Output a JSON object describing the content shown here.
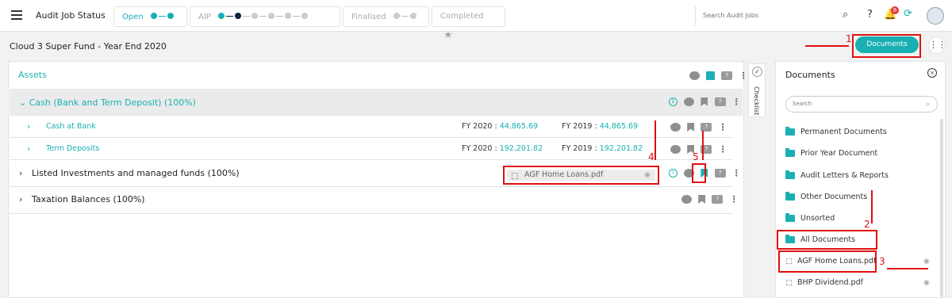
{
  "topbar": {
    "title": "Audit Job Status",
    "stages": [
      {
        "label": "Open"
      },
      {
        "label": "AIP"
      },
      {
        "label": "Finalised"
      },
      {
        "label": "Completed"
      }
    ],
    "search_placeholder": "Search Audit Jobs",
    "notification_count": "8"
  },
  "page": {
    "title": "Cloud 3 Super Fund - Year End 2020",
    "documents_button": "Documents"
  },
  "main": {
    "section": "Assets",
    "group": "Cash (Bank and Term Deposit) (100%)",
    "group_badge": "1",
    "rows": [
      {
        "label": "Cash at Bank",
        "fy2020_label": "FY 2020 :",
        "fy2020": "44,865.69",
        "fy2019_label": "FY 2019 :",
        "fy2019": "44,865.69"
      },
      {
        "label": "Term Deposits",
        "fy2020_label": "FY 2020 :",
        "fy2020": "192,201.82",
        "fy2019_label": "FY 2019 :",
        "fy2019": "192,201.82"
      }
    ],
    "listed": "Listed Investments and managed funds (100%)",
    "attached_file": "AGF Home Loans.pdf",
    "taxation": "Taxation Balances (100%)"
  },
  "checklist": {
    "label": "Checklist"
  },
  "documents_panel": {
    "title": "Documents",
    "search_placeholder": "Search",
    "folders": [
      "Permanent Documents",
      "Prior Year Document",
      "Audit Letters & Reports",
      "Other Documents",
      "Unsorted",
      "All Documents"
    ],
    "files": [
      "AGF Home Loans.pdf",
      "BHP Dividend.pdf"
    ]
  },
  "annotations": {
    "n1": "1",
    "n2": "2",
    "n3": "3",
    "n4": "4",
    "n5": "5"
  },
  "colors": {
    "accent": "#1ab0b3",
    "annotation": "#e01010",
    "dark_dot": "#0a2240"
  }
}
